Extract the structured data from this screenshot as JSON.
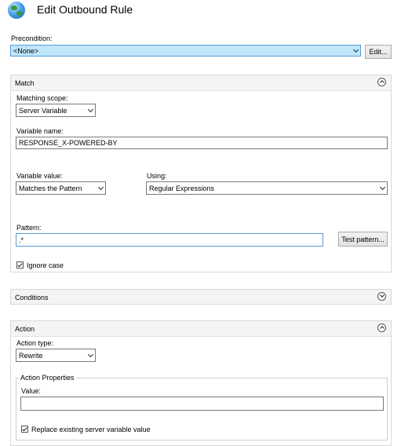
{
  "window": {
    "title": "Edit Outbound Rule",
    "icon": "globe-icon"
  },
  "precondition": {
    "label": "Precondition:",
    "value": "<None>",
    "edit_button": "Edit..."
  },
  "match": {
    "header": "Match",
    "matching_scope_label": "Matching scope:",
    "matching_scope_value": "Server Variable",
    "variable_name_label": "Variable name:",
    "variable_name_value": "RESPONSE_X-POWERED-BY",
    "variable_value_label": "Variable value:",
    "variable_value_value": "Matches the Pattern",
    "using_label": "Using:",
    "using_value": "Regular Expressions",
    "pattern_label": "Pattern:",
    "pattern_value": ".*",
    "test_pattern_button": "Test pattern...",
    "ignore_case_label": "Ignore case",
    "ignore_case_checked": true
  },
  "conditions": {
    "header": "Conditions"
  },
  "action": {
    "header": "Action",
    "action_type_label": "Action type:",
    "action_type_value": "Rewrite",
    "properties_legend": "Action Properties",
    "value_label": "Value:",
    "value_value": "",
    "replace_label": "Replace existing server variable value",
    "replace_checked": true
  },
  "colors": {
    "selected_field": "#bfe6f9",
    "panel_header": "#f4f4f4"
  }
}
